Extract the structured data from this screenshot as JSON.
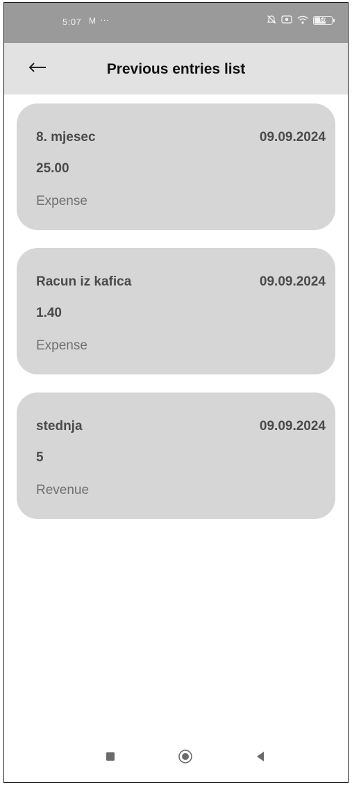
{
  "status_bar": {
    "time": "5:07",
    "notif": "M",
    "more": "···",
    "battery": "56",
    "icons": [
      "alarm-off-icon",
      "screen-record-icon",
      "wifi-icon",
      "battery-icon"
    ]
  },
  "header": {
    "title": "Previous entries list",
    "back_icon": "arrow-left-icon"
  },
  "entries": [
    {
      "name": "8. mjesec",
      "date": "09.09.2024",
      "amount": "25.00",
      "type": "Expense"
    },
    {
      "name": "Racun iz kafica",
      "date": "09.09.2024",
      "amount": "1.40",
      "type": "Expense"
    },
    {
      "name": "stednja",
      "date": "09.09.2024",
      "amount": "5",
      "type": "Revenue"
    }
  ],
  "nav_bar": {
    "icons": [
      "recents-square-icon",
      "home-circle-icon",
      "back-triangle-icon"
    ]
  },
  "colors": {
    "status_bar": "#9a9a9a",
    "app_bar": "#e2e2e2",
    "card": "#d6d6d6",
    "text_strong": "#4a4a4a",
    "text_muted": "#707070"
  }
}
